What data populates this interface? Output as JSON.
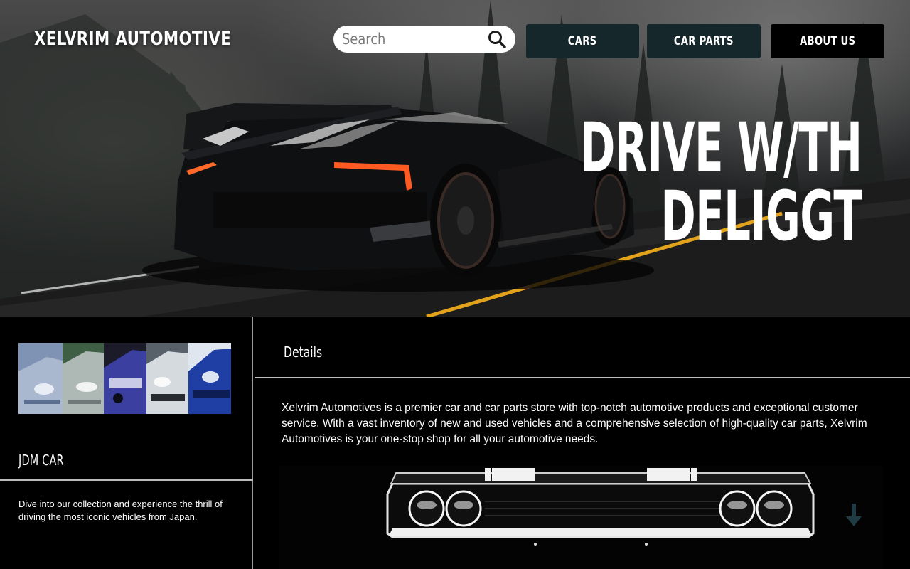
{
  "header": {
    "brand": "XELVRIM AUTOMOTIVE",
    "search": {
      "placeholder": "Search",
      "value": "",
      "icon": "search-icon"
    },
    "nav": [
      {
        "label": "CARS"
      },
      {
        "label": "CAR PARTS"
      },
      {
        "label": "ABOUT US"
      }
    ]
  },
  "hero": {
    "headline_line1": "DRIVE W/TH",
    "headline_line2": "DELIGGT"
  },
  "left_panel": {
    "title": "JDM CAR",
    "description": "Dive into our collection and experience the thrill of driving the most iconic vehicles from Japan."
  },
  "details": {
    "title": "Details",
    "body": "Xelvrim Automotives is a premier car and car parts store with top-notch automotive products and exceptional customer service. With a vast inventory of new and used vehicles and a comprehensive selection of high-quality car parts, Xelvrim Automotives is your one-stop shop for all your automotive needs.",
    "scroll_icon": "arrow-down-icon"
  },
  "colors": {
    "nav_button": "#16272b",
    "about_button": "#000000",
    "background": "#000000",
    "divider": "#bdbdbd",
    "scroll_arrow": "#1f3b44"
  }
}
